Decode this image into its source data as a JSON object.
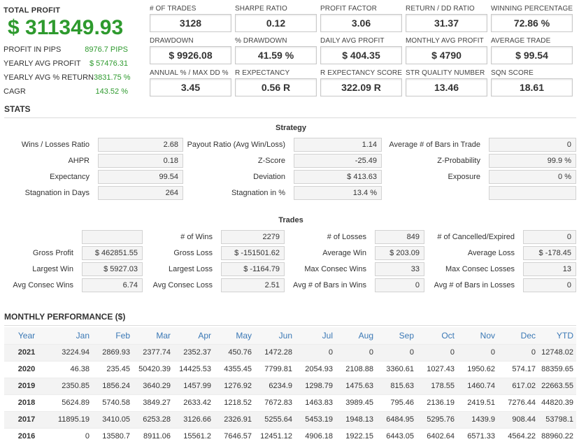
{
  "summary": {
    "total_profit_label": "TOTAL PROFIT",
    "total_profit_value": "$ 311349.93",
    "rows": [
      {
        "label": "PROFIT IN PIPS",
        "value": "8976.7 PIPS"
      },
      {
        "label": "YEARLY AVG PROFIT",
        "value": "$ 57476.31"
      },
      {
        "label": "YEARLY AVG % RETURN",
        "value": "3831.75 %"
      },
      {
        "label": "CAGR",
        "value": "143.52 %"
      }
    ]
  },
  "metrics": [
    {
      "label": "# OF TRADES",
      "value": "3128"
    },
    {
      "label": "SHARPE RATIO",
      "value": "0.12"
    },
    {
      "label": "PROFIT FACTOR",
      "value": "3.06"
    },
    {
      "label": "RETURN / DD RATIO",
      "value": "31.37"
    },
    {
      "label": "WINNING PERCENTAGE",
      "value": "72.86 %"
    },
    {
      "label": "DRAWDOWN",
      "value": "$ 9926.08"
    },
    {
      "label": "% DRAWDOWN",
      "value": "41.59 %"
    },
    {
      "label": "DAILY AVG PROFIT",
      "value": "$ 404.35"
    },
    {
      "label": "MONTHLY AVG PROFIT",
      "value": "$ 4790"
    },
    {
      "label": "AVERAGE TRADE",
      "value": "$ 99.54"
    },
    {
      "label": "ANNUAL % / MAX DD %",
      "value": "3.45"
    },
    {
      "label": "R EXPECTANCY",
      "value": "0.56 R"
    },
    {
      "label": "R EXPECTANCY SCORE",
      "value": "322.09 R"
    },
    {
      "label": "STR QUALITY NUMBER",
      "value": "13.46"
    },
    {
      "label": "SQN SCORE",
      "value": "18.61"
    }
  ],
  "stats": {
    "title": "STATS",
    "strategy": {
      "title": "Strategy",
      "rows": [
        [
          {
            "label": "Wins / Losses Ratio",
            "value": "2.68"
          },
          {
            "label": "Payout Ratio (Avg Win/Loss)",
            "value": "1.14"
          },
          {
            "label": "Average # of Bars in Trade",
            "value": "0"
          }
        ],
        [
          {
            "label": "AHPR",
            "value": "0.18"
          },
          {
            "label": "Z-Score",
            "value": "-25.49"
          },
          {
            "label": "Z-Probability",
            "value": "99.9 %"
          }
        ],
        [
          {
            "label": "Expectancy",
            "value": "99.54"
          },
          {
            "label": "Deviation",
            "value": "$ 413.63"
          },
          {
            "label": "Exposure",
            "value": "0 %"
          }
        ],
        [
          {
            "label": "Stagnation in Days",
            "value": "264"
          },
          {
            "label": "Stagnation in %",
            "value": "13.4 %"
          },
          {
            "label": "",
            "value": ""
          }
        ]
      ]
    },
    "trades": {
      "title": "Trades",
      "rows": [
        [
          {
            "label": "",
            "value": ""
          },
          {
            "label": "# of Wins",
            "value": "2279"
          },
          {
            "label": "# of Losses",
            "value": "849"
          },
          {
            "label": "# of Cancelled/Expired",
            "value": "0"
          }
        ],
        [
          {
            "label": "Gross Profit",
            "value": "$ 462851.55"
          },
          {
            "label": "Gross Loss",
            "value": "$ -151501.62"
          },
          {
            "label": "Average Win",
            "value": "$ 203.09"
          },
          {
            "label": "Average Loss",
            "value": "$ -178.45"
          }
        ],
        [
          {
            "label": "Largest Win",
            "value": "$ 5927.03"
          },
          {
            "label": "Largest Loss",
            "value": "$ -1164.79"
          },
          {
            "label": "Max Consec Wins",
            "value": "33"
          },
          {
            "label": "Max Consec Losses",
            "value": "13"
          }
        ],
        [
          {
            "label": "Avg Consec Wins",
            "value": "6.74"
          },
          {
            "label": "Avg Consec Loss",
            "value": "2.51"
          },
          {
            "label": "Avg # of Bars in Wins",
            "value": "0"
          },
          {
            "label": "Avg # of Bars in Losses",
            "value": "0"
          }
        ]
      ]
    }
  },
  "monthly": {
    "title": "MONTHLY PERFORMANCE ($)",
    "headers": [
      "Year",
      "Jan",
      "Feb",
      "Mar",
      "Apr",
      "May",
      "Jun",
      "Jul",
      "Aug",
      "Sep",
      "Oct",
      "Nov",
      "Dec",
      "YTD"
    ],
    "rows": [
      [
        "2021",
        "3224.94",
        "2869.93",
        "2377.74",
        "2352.37",
        "450.76",
        "1472.28",
        "0",
        "0",
        "0",
        "0",
        "0",
        "0",
        "12748.02"
      ],
      [
        "2020",
        "46.38",
        "235.45",
        "50420.39",
        "14425.53",
        "4355.45",
        "7799.81",
        "2054.93",
        "2108.88",
        "3360.61",
        "1027.43",
        "1950.62",
        "574.17",
        "88359.65"
      ],
      [
        "2019",
        "2350.85",
        "1856.24",
        "3640.29",
        "1457.99",
        "1276.92",
        "6234.9",
        "1298.79",
        "1475.63",
        "815.63",
        "178.55",
        "1460.74",
        "617.02",
        "22663.55"
      ],
      [
        "2018",
        "5624.89",
        "5740.58",
        "3849.27",
        "2633.42",
        "1218.52",
        "7672.83",
        "1463.83",
        "3989.45",
        "795.46",
        "2136.19",
        "2419.51",
        "7276.44",
        "44820.39"
      ],
      [
        "2017",
        "11895.19",
        "3410.05",
        "6253.28",
        "3126.66",
        "2326.91",
        "5255.64",
        "5453.19",
        "1948.13",
        "6484.95",
        "5295.76",
        "1439.9",
        "908.44",
        "53798.1"
      ],
      [
        "2016",
        "0",
        "13580.7",
        "8911.06",
        "15561.2",
        "7646.57",
        "12451.12",
        "4906.18",
        "1922.15",
        "6443.05",
        "6402.64",
        "6571.33",
        "4564.22",
        "88960.22"
      ]
    ]
  }
}
